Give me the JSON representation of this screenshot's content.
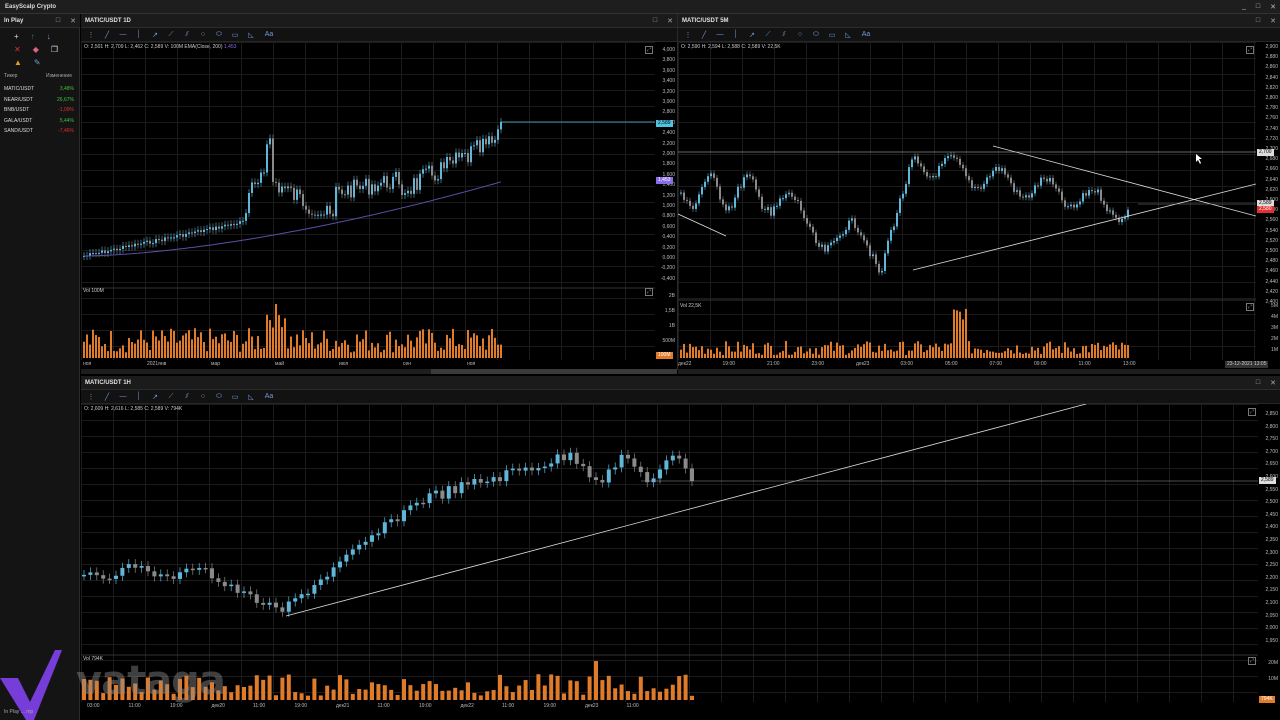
{
  "app": {
    "title": "EasyScalp Crypto",
    "controls": [
      "_",
      "□",
      "✕"
    ]
  },
  "sidebar": {
    "panel_title": "In Play",
    "table_headers": {
      "ticker": "Тикер",
      "change": "Изменение"
    },
    "rows": [
      {
        "ticker": "MATIC/USDT",
        "change": "3,48%",
        "status": "pos"
      },
      {
        "ticker": "NEAR/USDT",
        "change": "26,67%",
        "status": "pos"
      },
      {
        "ticker": "BNB/USDT",
        "change": "-1,09%",
        "status": "neg"
      },
      {
        "ticker": "GALA/USDT",
        "change": "5,44%",
        "status": "pos"
      },
      {
        "ticker": "SAND/USDT",
        "change": "-7,46%",
        "status": "neg"
      }
    ],
    "status_text": "In Play ... mp"
  },
  "chart1": {
    "title": "MATIC/USDT 1D",
    "ohlc": "O: 2,501  H: 2,709  L: 2,462  C: 2,589  V: 100M  EMA(Close, 200)",
    "ema_value": "1,453",
    "price_tag": "2,589",
    "ema_tag": "1,453",
    "vol_label": "Vol 100M",
    "y_ticks": [
      "4,000",
      "3,800",
      "3,600",
      "3,400",
      "3,200",
      "3,000",
      "2,800",
      "2,600",
      "2,400",
      "2,200",
      "2,000",
      "1,800",
      "1,600",
      "1,400",
      "1,200",
      "1,000",
      "0,800",
      "0,600",
      "0,400",
      "0,200",
      "0,000",
      "-0,200",
      "-0,400"
    ],
    "vol_ticks": [
      "2B",
      "1,5B",
      "1B",
      "500M"
    ],
    "vol_tag": "100M",
    "x_ticks": [
      "ноя",
      "2021янв",
      "мар",
      "май",
      "июл",
      "сен",
      "ноя"
    ]
  },
  "chart2": {
    "title": "MATIC/USDT 5M",
    "ohlc": "O: 2,590  H: 2,594  L: 2,588  C: 2,589  V: 22,5K",
    "price_tag": "2,589",
    "line_tag": "2,700",
    "low_tag": "2,580",
    "vol_label": "Vol 22,5K",
    "y_ticks": [
      "2,900",
      "2,880",
      "2,860",
      "2,840",
      "2,820",
      "2,800",
      "2,780",
      "2,760",
      "2,740",
      "2,720",
      "2,700",
      "2,680",
      "2,660",
      "2,640",
      "2,620",
      "2,600",
      "2,580",
      "2,560",
      "2,540",
      "2,520",
      "2,500",
      "2,480",
      "2,460",
      "2,440",
      "2,420",
      "2,400"
    ],
    "vol_ticks": [
      "5M",
      "4M",
      "3M",
      "2M",
      "1M"
    ],
    "vol_tag": "22,5K",
    "x_ticks": [
      "дек22",
      "19:00",
      "21:00",
      "23:00",
      "дек23",
      "03:00",
      "05:00",
      "07:00",
      "09:00",
      "11:00",
      "13:00"
    ],
    "date_tag": "23-12-2021 13:05"
  },
  "chart3": {
    "title": "MATIC/USDT 1H",
    "ohlc": "O: 2,609  H: 2,616  L: 2,585  C: 2,589  V: 794K",
    "price_tag": "2,589",
    "vol_label": "Vol 794K",
    "y_ticks": [
      "2,850",
      "2,800",
      "2,750",
      "2,700",
      "2,650",
      "2,600",
      "2,550",
      "2,500",
      "2,450",
      "2,400",
      "2,350",
      "2,300",
      "2,250",
      "2,200",
      "2,150",
      "2,100",
      "2,050",
      "2,000",
      "1,950"
    ],
    "vol_ticks": [
      "20M",
      "10M"
    ],
    "vol_tag": "794K",
    "x_ticks": [
      "03:00",
      "11:00",
      "19:00",
      "дек20",
      "11:00",
      "19:00",
      "дек21",
      "11:00",
      "19:00",
      "дек22",
      "11:00",
      "19:00",
      "дек23",
      "11:00"
    ]
  },
  "toolbar_icons": [
    "menu-dots-icon",
    "pencil-line-icon",
    "horizontal-line-icon",
    "vertical-line-icon",
    "arrow-icon",
    "ray-icon",
    "channel-icon",
    "circle-icon",
    "ellipse-icon",
    "rectangle-icon",
    "fib-icon",
    "text-icon"
  ],
  "toolbar_text_label": "Aa",
  "watermark": "vataga",
  "colors": {
    "bull": "#5fb6d9",
    "bear": "#8a8a8a",
    "volume": "#e07b2a",
    "ema": "#5b4fa8",
    "price_tag": "#4fc3e0",
    "ema_tag": "#8a6be8",
    "pos": "#3ec43e",
    "neg": "#e03030"
  }
}
